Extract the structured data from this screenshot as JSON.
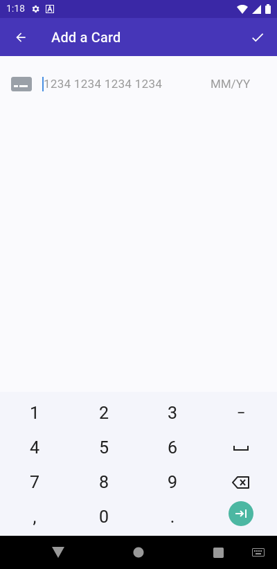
{
  "status_bar": {
    "time": "1:18",
    "icons": [
      "gear-icon",
      "a-icon",
      "wifi-icon",
      "cell-signal-icon",
      "battery-icon"
    ]
  },
  "app_bar": {
    "title": "Add a Card",
    "back_icon": "arrow-left-icon",
    "confirm_icon": "checkmark-icon",
    "color": "#4636b8"
  },
  "card_form": {
    "card_icon": "credit-card-icon",
    "card_number_placeholder": "1234 1234 1234 1234",
    "card_number_value": "",
    "expiry_placeholder": "MM/YY",
    "expiry_value": ""
  },
  "keyboard": {
    "rows": [
      [
        "1",
        "2",
        "3",
        "−"
      ],
      [
        "4",
        "5",
        "6",
        "␣"
      ],
      [
        "7",
        "8",
        "9",
        "⌫"
      ],
      [
        ",",
        "0",
        ".",
        "⇥"
      ]
    ],
    "key_1": "1",
    "key_2": "2",
    "key_3": "3",
    "key_minus": "−",
    "key_4": "4",
    "key_5": "5",
    "key_6": "6",
    "key_7": "7",
    "key_8": "8",
    "key_9": "9",
    "key_comma": ",",
    "key_0": "0",
    "key_period": ".",
    "action_color": "#4cb7a2"
  },
  "nav_bar": {
    "icons": [
      "back-triangle-icon",
      "home-circle-icon",
      "recents-square-icon",
      "keyboard-icon"
    ]
  }
}
